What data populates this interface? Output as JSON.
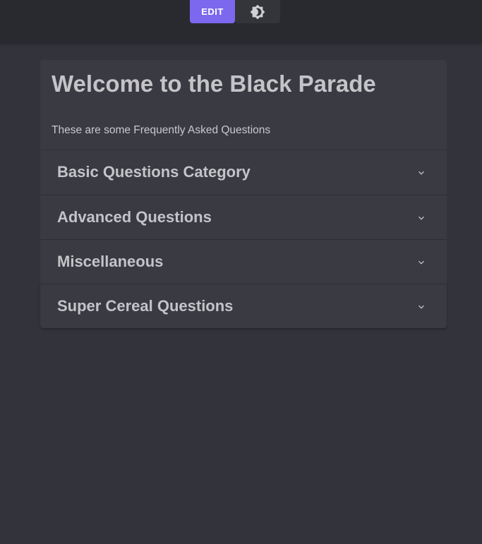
{
  "toolbar": {
    "edit_label": "EDIT",
    "theme_icon": "brightness-icon"
  },
  "header": {
    "title": "Welcome to the Black Parade",
    "subtitle": "These are some Frequently Asked Questions"
  },
  "faq": {
    "categories": [
      {
        "label": "Basic Questions Category",
        "expanded": false
      },
      {
        "label": "Advanced Questions",
        "expanded": false
      },
      {
        "label": "Miscellaneous",
        "expanded": false
      },
      {
        "label": "Super Cereal Questions",
        "expanded": false
      }
    ]
  },
  "colors": {
    "background": "#33333b",
    "topbar": "#292a30",
    "card": "#393a42",
    "accent": "#7b68ee",
    "text": "#c4c4c8"
  }
}
